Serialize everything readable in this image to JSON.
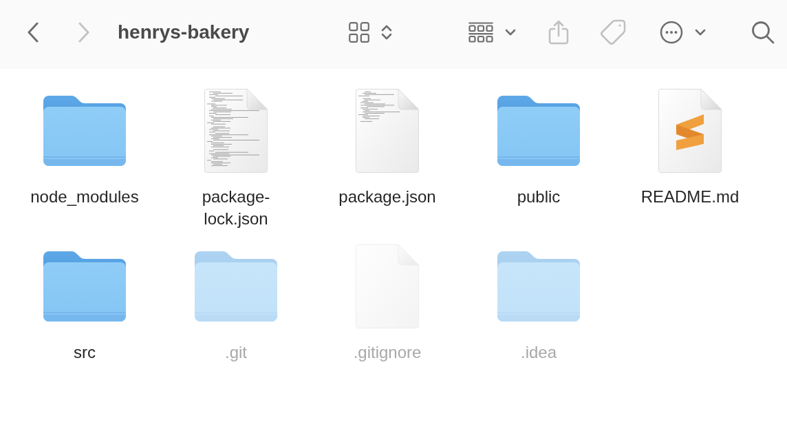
{
  "window": {
    "title": "henrys-bakery"
  },
  "navigation": [
    {
      "kind": "back",
      "disabled": false
    },
    {
      "kind": "forward",
      "disabled": true
    }
  ],
  "toolbar": [
    {
      "kind": "view",
      "disabled": false
    },
    {
      "kind": "group",
      "disabled": false
    },
    {
      "kind": "share",
      "disabled": true
    },
    {
      "kind": "tags",
      "disabled": true
    },
    {
      "kind": "more",
      "disabled": false
    },
    {
      "kind": "search",
      "disabled": false
    }
  ],
  "files": [
    {
      "name": "node_modules",
      "kind": "folder",
      "hidden": false
    },
    {
      "name": "package-lock.json",
      "kind": "listing",
      "hidden": false
    },
    {
      "name": "package.json",
      "kind": "snippet",
      "hidden": false
    },
    {
      "name": "public",
      "kind": "folder",
      "hidden": false
    },
    {
      "name": "README.md",
      "kind": "logo",
      "hidden": false
    },
    {
      "name": "src",
      "kind": "folder",
      "hidden": false
    },
    {
      "name": ".git",
      "kind": "folder",
      "hidden": true
    },
    {
      "name": ".gitignore",
      "kind": "blank",
      "hidden": true
    },
    {
      "name": ".idea",
      "kind": "folder",
      "hidden": true
    }
  ]
}
